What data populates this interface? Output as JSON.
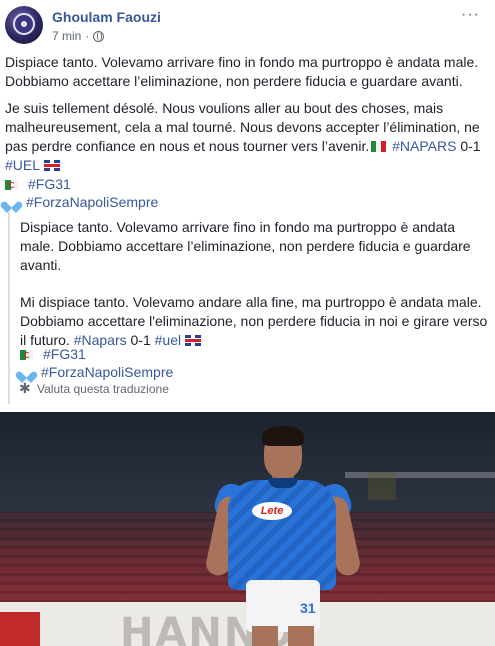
{
  "post": {
    "author": "Ghoulam Faouzi",
    "time": "7 min",
    "separator": "·",
    "more_label": "···",
    "p1": "Dispiace tanto. Volevamo arrivare fino in fondo ma purtroppo è andata male. Dobbiamo accettare l’eliminazione, non perdere fiducia e guardare avanti.",
    "p2": "Je suis tellement désolé. Nous voulions aller au bout des choses, mais malheureusement, cela a mal tourné. Nous devons accepter l’élimination, ne pas perdre confiance en nous et nous tourner vers l’avenir.",
    "tag_napars": "#NAPARS",
    "score": "0-1",
    "tag_uel": "#UEL",
    "tag_fg31": "#FG31",
    "tag_forza": "#ForzaNapoliSempre"
  },
  "translation": {
    "t1": "Dispiace tanto. Volevamo arrivare fino in fondo ma purtroppo è andata male. Dobbiamo accettare l’eliminazione, non perdere fiducia e guardare avanti.",
    "t2": "Mi dispiace tanto. Volevamo andare alla fine, ma purtroppo è andata male. Dobbiamo accettare l'eliminazione, non perdere fiducia in noi e girare verso il futuro.",
    "tag_napars": "#Napars",
    "score": "0-1",
    "tag_uel": "#uel",
    "tag_fg31": "#FG31",
    "tag_forza": "#ForzaNapoliSempre",
    "rate_label": "Valuta questa traduzione"
  },
  "photo": {
    "sponsor": "Lete",
    "shirt_number": "31",
    "board_text": "HANNOI"
  },
  "colors": {
    "link": "#385898",
    "text": "#1d2129",
    "meta": "#606770"
  }
}
